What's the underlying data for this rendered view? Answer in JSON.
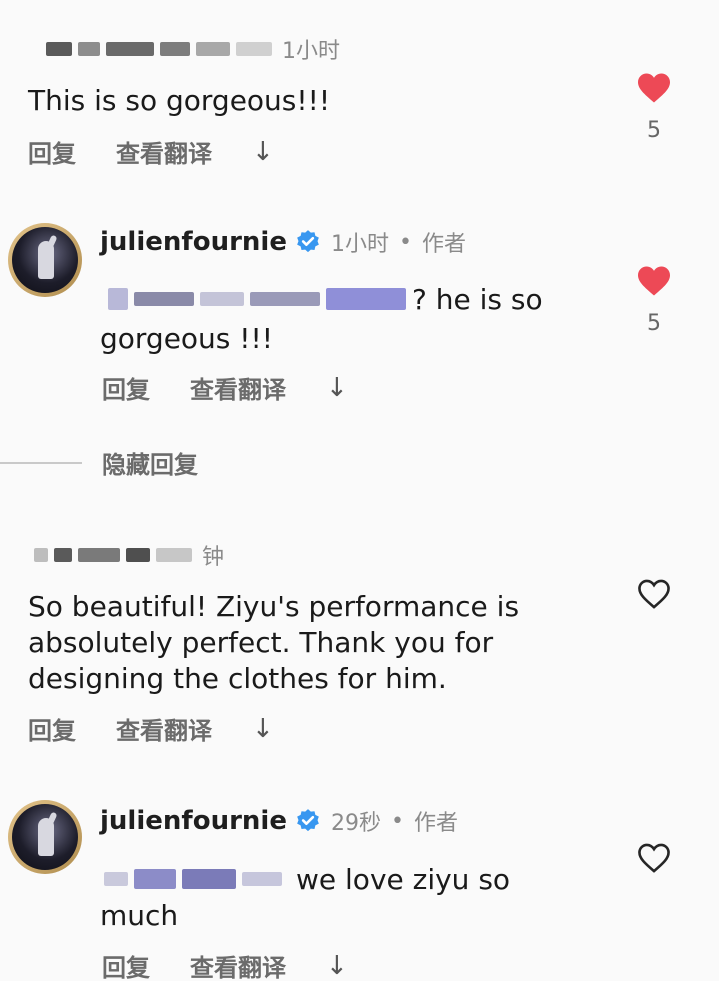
{
  "comments": [
    {
      "time": "1小时",
      "text": "This is so gorgeous!!!",
      "likes": "5",
      "liked": true
    },
    {
      "username": "julienfournie",
      "time": "1小时",
      "author_tag": "作者",
      "mention_suffix": "? he is so",
      "text_line2": "gorgeous !!!",
      "likes": "5",
      "liked": true
    },
    {
      "time": "钟",
      "text_line1": "So beautiful! Ziyu's performance is",
      "text_line2": "absolutely perfect. Thank you for",
      "text_line3": "designing the clothes for him.",
      "liked": false
    },
    {
      "username": "julienfournie",
      "time": "29秒",
      "author_tag": "作者",
      "mention_suffix": "we love ziyu so",
      "text_line2": "much",
      "liked": false
    }
  ],
  "actions": {
    "reply": "回复",
    "translate": "查看翻译",
    "arrow": "↓"
  },
  "hide_replies": "隐藏回复",
  "meta_separator": "•",
  "colors": {
    "like_red": "#ed4956",
    "verified_blue": "#3897f0",
    "muted": "#8a8a8a"
  }
}
